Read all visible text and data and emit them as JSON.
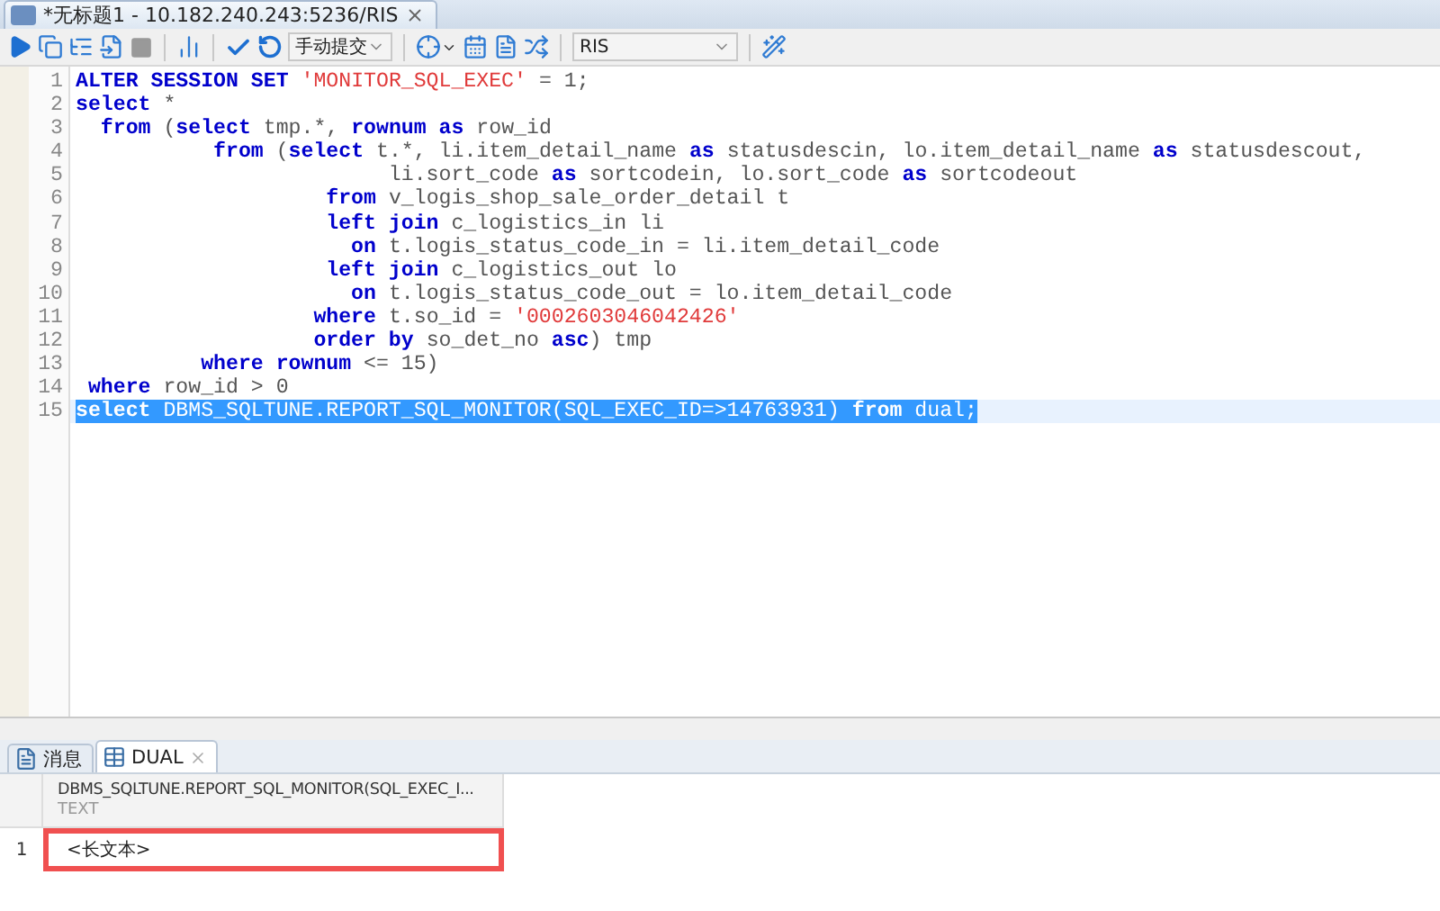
{
  "window": {
    "title": "*无标题1 - 10.182.240.243:5236/RIS"
  },
  "toolbar": {
    "commit_mode": "手动提交",
    "schema": "RIS"
  },
  "editor": {
    "lines": [
      {
        "number": "1",
        "selected": false,
        "tokens": [
          {
            "kind": "kw",
            "t": "ALTER SESSION SET"
          },
          {
            "kind": "str",
            "t": " 'MONITOR_SQL_EXEC'"
          },
          {
            "kind": "id",
            "t": " = 1;"
          }
        ]
      },
      {
        "number": "2",
        "selected": false,
        "tokens": [
          {
            "kind": "kw",
            "t": "select"
          },
          {
            "kind": "id",
            "t": " *"
          }
        ]
      },
      {
        "number": "3",
        "selected": false,
        "tokens": [
          {
            "kind": "kw",
            "t": "  from"
          },
          {
            "kind": "id",
            "t": " ("
          },
          {
            "kind": "kw",
            "t": "select"
          },
          {
            "kind": "id",
            "t": " tmp.*, "
          },
          {
            "kind": "kw",
            "t": "rownum as"
          },
          {
            "kind": "id",
            "t": " row_id"
          }
        ]
      },
      {
        "number": "4",
        "selected": false,
        "tokens": [
          {
            "kind": "kw",
            "t": "           from"
          },
          {
            "kind": "id",
            "t": " ("
          },
          {
            "kind": "kw",
            "t": "select"
          },
          {
            "kind": "id",
            "t": " t.*, li.item_detail_name "
          },
          {
            "kind": "kw",
            "t": "as"
          },
          {
            "kind": "id",
            "t": " statusdescin, lo.item_detail_name "
          },
          {
            "kind": "kw",
            "t": "as"
          },
          {
            "kind": "id",
            "t": " statusdescout,"
          }
        ]
      },
      {
        "number": "5",
        "selected": false,
        "tokens": [
          {
            "kind": "id",
            "t": "                         li.sort_code "
          },
          {
            "kind": "kw",
            "t": "as"
          },
          {
            "kind": "id",
            "t": " sortcodein, lo.sort_code "
          },
          {
            "kind": "kw",
            "t": "as"
          },
          {
            "kind": "id",
            "t": " sortcodeout"
          }
        ]
      },
      {
        "number": "6",
        "selected": false,
        "tokens": [
          {
            "kind": "kw",
            "t": "                    from"
          },
          {
            "kind": "id",
            "t": " v_logis_shop_sale_order_detail t"
          }
        ]
      },
      {
        "number": "7",
        "selected": false,
        "tokens": [
          {
            "kind": "kw",
            "t": "                    left join"
          },
          {
            "kind": "id",
            "t": " c_logistics_in li"
          }
        ]
      },
      {
        "number": "8",
        "selected": false,
        "tokens": [
          {
            "kind": "kw",
            "t": "                      on"
          },
          {
            "kind": "id",
            "t": " t.logis_status_code_in = li.item_detail_code"
          }
        ]
      },
      {
        "number": "9",
        "selected": false,
        "tokens": [
          {
            "kind": "kw",
            "t": "                    left join"
          },
          {
            "kind": "id",
            "t": " c_logistics_out lo"
          }
        ]
      },
      {
        "number": "10",
        "selected": false,
        "tokens": [
          {
            "kind": "kw",
            "t": "                      on"
          },
          {
            "kind": "id",
            "t": " t.logis_status_code_out = lo.item_detail_code"
          }
        ]
      },
      {
        "number": "11",
        "selected": false,
        "tokens": [
          {
            "kind": "kw",
            "t": "                   where"
          },
          {
            "kind": "id",
            "t": " t.so_id = "
          },
          {
            "kind": "str",
            "t": "'0002603046042426'"
          }
        ]
      },
      {
        "number": "12",
        "selected": false,
        "tokens": [
          {
            "kind": "kw",
            "t": "                   order by"
          },
          {
            "kind": "id",
            "t": " so_det_no "
          },
          {
            "kind": "kw",
            "t": "asc"
          },
          {
            "kind": "id",
            "t": ") tmp"
          }
        ]
      },
      {
        "number": "13",
        "selected": false,
        "tokens": [
          {
            "kind": "kw",
            "t": "          where rownum"
          },
          {
            "kind": "id",
            "t": " <= 15)"
          }
        ]
      },
      {
        "number": "14",
        "selected": false,
        "tokens": [
          {
            "kind": "kw",
            "t": " where"
          },
          {
            "kind": "id",
            "t": " row_id > 0"
          }
        ]
      },
      {
        "number": "15",
        "selected": true,
        "tokens": [
          {
            "kind": "kw",
            "t": "select"
          },
          {
            "kind": "id",
            "t": " DBMS_SQLTUNE.REPORT_SQL_MONITOR(SQL_EXEC_ID=>14763931) "
          },
          {
            "kind": "kw",
            "t": "from"
          },
          {
            "kind": "id",
            "t": " dual;"
          }
        ]
      }
    ]
  },
  "results": {
    "tabs": [
      {
        "label": "消息",
        "kind": "messages",
        "selected": false
      },
      {
        "label": "DUAL",
        "kind": "table",
        "selected": true
      }
    ],
    "columns": [
      {
        "name": "DBMS_SQLTUNE.REPORT_SQL_MONITOR(SQL_EXEC_I...",
        "type": "TEXT"
      }
    ],
    "rows": [
      {
        "number": "1",
        "cells": [
          "<长文本>"
        ],
        "highlighted": true
      }
    ]
  }
}
